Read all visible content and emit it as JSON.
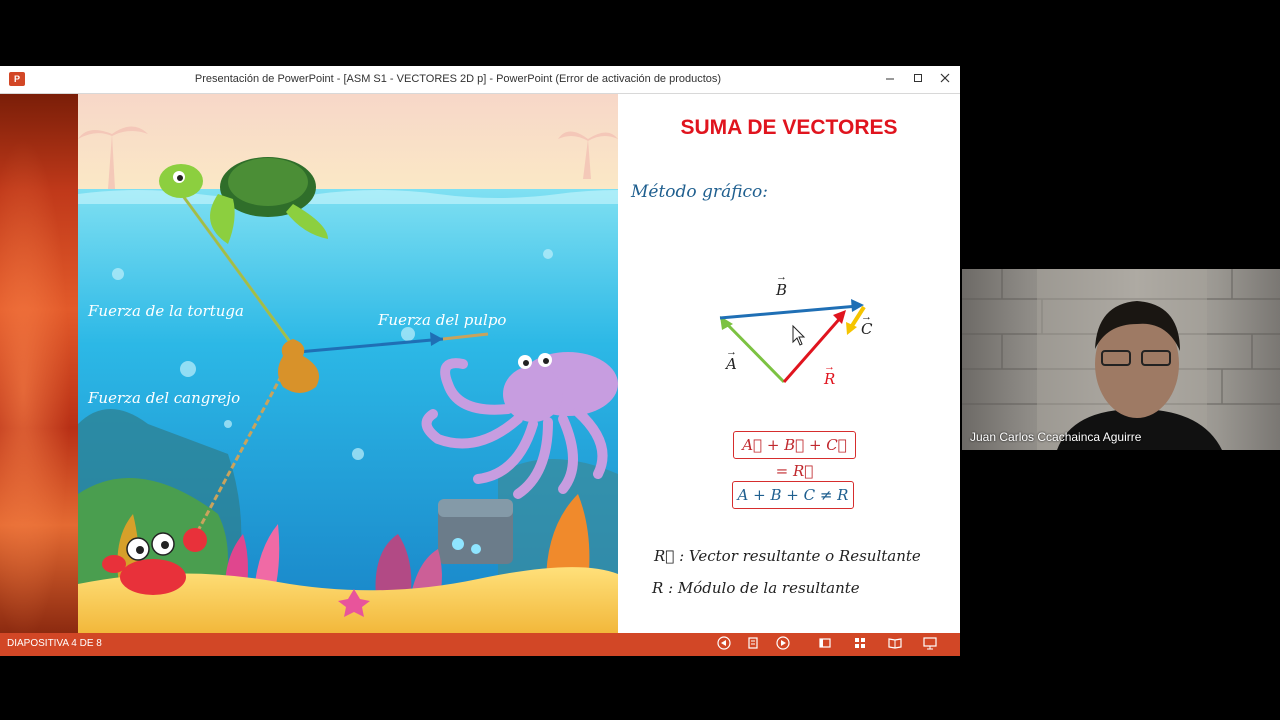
{
  "window": {
    "app_icon": "P",
    "title": "Presentación de PowerPoint - [ASM S1 - VECTORES 2D p] - PowerPoint (Error de activación de productos)",
    "minimize_icon": "minimize-icon",
    "maximize_icon": "maximize-icon",
    "close_icon": "close-icon"
  },
  "slide": {
    "title": "SUMA DE VECTORES",
    "method_label": "Método gráfico:",
    "scene_labels": {
      "turtle": "Fuerza de la tortuga",
      "octopus": "Fuerza del pulpo",
      "crab": "Fuerza del cangrejo"
    },
    "vector_labels": {
      "a": "A",
      "b": "B",
      "c": "C",
      "r": "R"
    },
    "equation_vector": "A⃗ + B⃗ + C⃗ = R⃗",
    "equation_modulus": "A + B + C ≠ R",
    "definitions": [
      {
        "symbol": "R⃗",
        "text": ": Vector resultante o Resultante"
      },
      {
        "symbol": "R",
        "text": ": Módulo de la resultante"
      }
    ]
  },
  "statusbar": {
    "slide_indicator": "DIAPOSITIVA 4 DE 8",
    "buttons": [
      "prev-icon",
      "notes-icon",
      "next-icon",
      "normal-view-icon",
      "slide-sorter-icon",
      "reading-view-icon",
      "slideshow-icon"
    ]
  },
  "webcam": {
    "participant_name": "Juan Carlos Ccachainca Aguirre"
  },
  "colors": {
    "accent": "#d24726",
    "title_red": "#e0141e",
    "vector_a": "#7cc242",
    "vector_b": "#1f6fb5",
    "vector_c": "#f5c400",
    "vector_r": "#e0141e"
  }
}
